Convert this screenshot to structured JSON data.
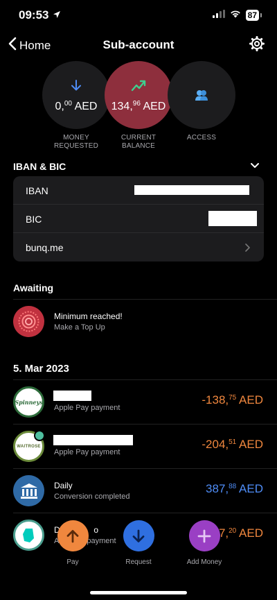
{
  "status": {
    "time": "09:53",
    "battery": "87"
  },
  "nav": {
    "back_label": "Home",
    "title": "Sub-account"
  },
  "summary": {
    "requested": {
      "whole": "0,",
      "cents": "00",
      "currency": " AED",
      "label": "MONEY REQUESTED"
    },
    "balance": {
      "whole": "134,",
      "cents": "96",
      "currency": " AED",
      "label": "CURRENT BALANCE"
    },
    "access": {
      "label": "ACCESS"
    }
  },
  "iban_section": {
    "title": "IBAN & BIC",
    "rows": [
      {
        "label": "IBAN"
      },
      {
        "label": "BIC"
      },
      {
        "label": "bunq.me"
      }
    ]
  },
  "awaiting": {
    "title": "Awaiting",
    "item": {
      "title": "Minimum reached!",
      "subtitle": "Make a Top Up"
    }
  },
  "transactions": {
    "date": "5. Mar 2023",
    "items": [
      {
        "title": "",
        "subtitle": "Apple Pay payment",
        "whole": "-138,",
        "cents": "75",
        "currency": " AED",
        "logo": "Spinneys",
        "color": "#f0873e"
      },
      {
        "title": "",
        "subtitle": "Apple Pay payment",
        "whole": "-204,",
        "cents": "51",
        "currency": " AED",
        "logo": "WAITROSE",
        "color": "#f0873e"
      },
      {
        "title": "Daily",
        "subtitle": "Conversion completed",
        "whole": "387,",
        "cents": "88",
        "currency": " AED",
        "logo": "bank-icon",
        "color": "#4f8df7"
      },
      {
        "title": "De",
        "title_end": "o",
        "subtitle": "A",
        "subtitle_end": "payment",
        "whole": "7,",
        "cents": "20",
        "currency": " AED",
        "logo": "deliveroo",
        "color": "#f0873e"
      }
    ]
  },
  "tabbar": {
    "pay": {
      "label": "Pay",
      "color": "#f0873e"
    },
    "request": {
      "label": "Request",
      "color": "#2f6fe0"
    },
    "add_money": {
      "label": "Add Money",
      "color": "#9a3fc4"
    }
  }
}
